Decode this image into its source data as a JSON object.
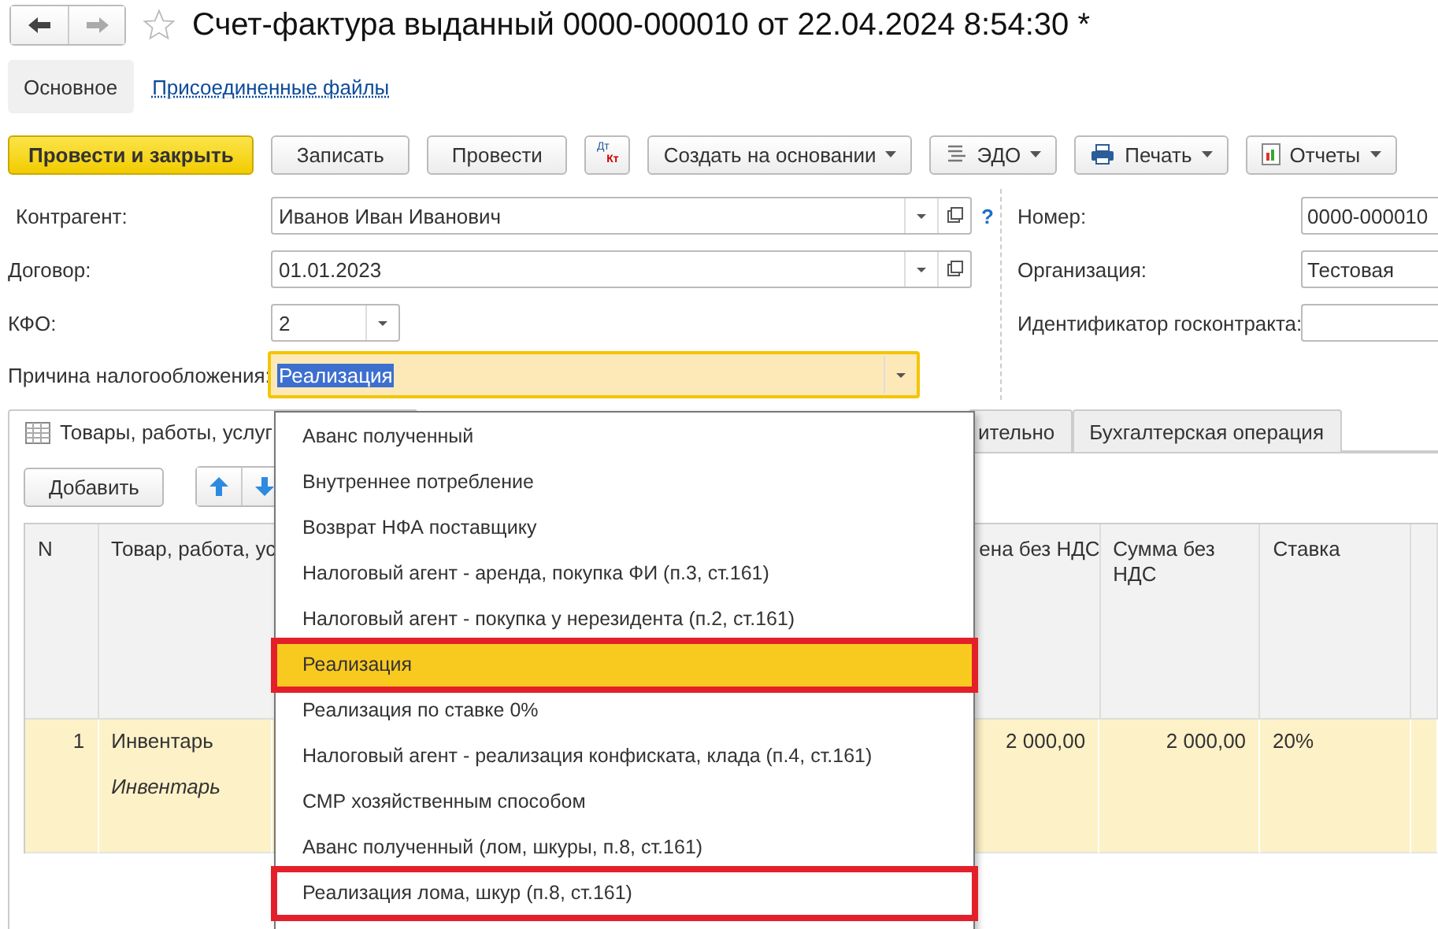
{
  "window": {
    "title": "Счет-фактура выданный 0000-000010 от 22.04.2024 8:54:30 *"
  },
  "nav_tabs": [
    {
      "label": "Основное",
      "selected": true
    },
    {
      "label": "Присоединенные файлы",
      "selected": false
    }
  ],
  "toolbar": [
    {
      "kind": "primary",
      "label": "Провести и закрыть"
    },
    {
      "kind": "plain",
      "label": "Записать"
    },
    {
      "kind": "plain",
      "label": "Провести"
    },
    {
      "kind": "dtkt",
      "label": "Дт",
      "label2": "Кт"
    },
    {
      "kind": "menu",
      "label": "Создать на основании"
    },
    {
      "kind": "menu",
      "label": "ЭДО"
    },
    {
      "kind": "menu",
      "label": "Печать"
    },
    {
      "kind": "menu",
      "label": "Отчеты"
    }
  ],
  "left_fields": [
    {
      "kind": "select_open",
      "label": "Контрагент:",
      "value": "Иванов Иван Иванович",
      "help": "?"
    },
    {
      "kind": "select_open",
      "label": "Договор:",
      "value": "01.01.2023"
    },
    {
      "kind": "select_short",
      "label": "КФО:",
      "value": "2"
    },
    {
      "kind": "combo",
      "label": "Причина налогообложения:",
      "value": "Реализация",
      "focused": true
    }
  ],
  "right_fields": [
    {
      "label": "Номер:",
      "value": "0000-000010"
    },
    {
      "label": "Организация:",
      "value": "Тестовая"
    },
    {
      "label": "Идентификатор госконтракта:"
    }
  ],
  "section_tabs": [
    {
      "label": "Товары, работы, услуг",
      "selected": true
    },
    {
      "label": "ительно",
      "selected": false
    },
    {
      "label": "Бухгалтерская операция",
      "selected": false
    }
  ],
  "table_toolbar": {
    "add_button": "Добавить"
  },
  "table": {
    "columns": [
      "N",
      "Товар, работа, ус",
      "ена без НДС",
      "Сумма без НДС",
      "Ставка"
    ],
    "rows": [
      {
        "cells": [
          "1",
          "Инвентарь",
          "2 000,00",
          "2 000,00",
          "20%"
        ],
        "subtitle": "Инвентарь",
        "selected": true
      }
    ]
  },
  "dropdown": {
    "items": [
      {
        "label": "Аванс полученный",
        "selected": false,
        "annotated": false
      },
      {
        "label": "Внутреннее потребление",
        "selected": false,
        "annotated": false
      },
      {
        "label": "Возврат НФА поставщику",
        "selected": false,
        "annotated": false
      },
      {
        "label": "Налоговый агент - аренда, покупка ФИ (п.3, ст.161)",
        "selected": false,
        "annotated": false
      },
      {
        "label": "Налоговый агент - покупка у нерезидента (п.2, ст.161)",
        "selected": false,
        "annotated": false
      },
      {
        "label": "Реализация",
        "selected": true,
        "annotated": true
      },
      {
        "label": "Реализация по ставке 0%",
        "selected": false,
        "annotated": false
      },
      {
        "label": "Налоговый агент - реализация конфиската, клада (п.4, ст.161)",
        "selected": false,
        "annotated": false
      },
      {
        "label": "СМР хозяйственным способом",
        "selected": false,
        "annotated": false
      },
      {
        "label": "Аванс полученный (лом, шкуры, п.8, ст.161)",
        "selected": false,
        "annotated": false
      },
      {
        "label": "Реализация лома, шкур (п.8, ст.161)",
        "selected": false,
        "annotated": true
      }
    ]
  }
}
